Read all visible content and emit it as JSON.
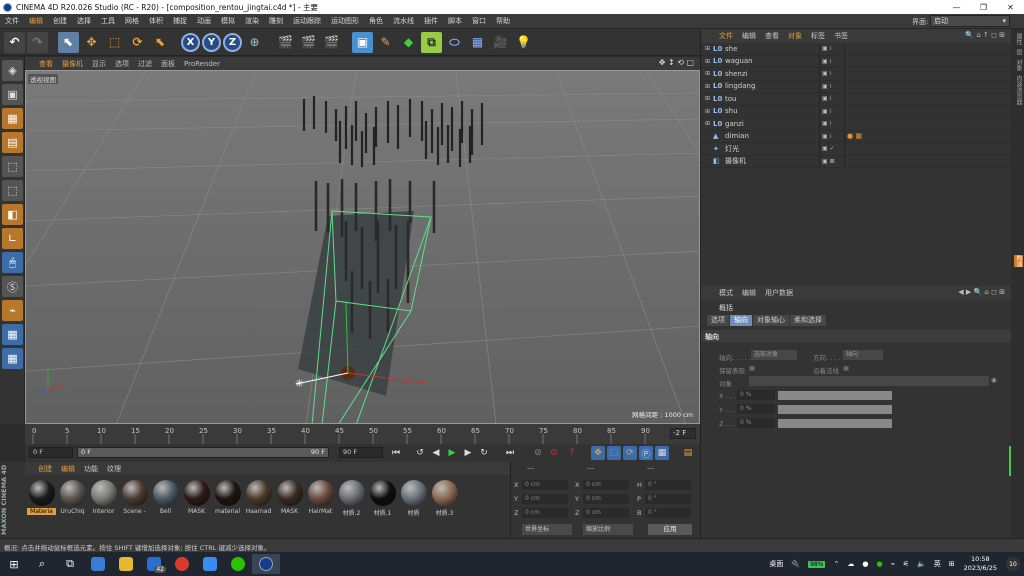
{
  "window": {
    "title": "CINEMA 4D R20.026 Studio (RC - R20) - [composition_rentou_jingtai.c4d *] - 主要",
    "minimize": "—",
    "maximize": "❐",
    "close": "✕"
  },
  "menu": {
    "items": [
      "文件",
      "编辑",
      "创建",
      "选择",
      "工具",
      "网格",
      "体积",
      "捕捉",
      "动画",
      "模拟",
      "渲染",
      "雕刻",
      "运动跟踪",
      "运动图形",
      "角色",
      "流水线",
      "插件",
      "脚本",
      "窗口",
      "帮助"
    ],
    "layout_label": "界面:",
    "layout_value": "启动"
  },
  "toolbar": {
    "axis_x": "X",
    "axis_y": "Y",
    "axis_z": "Z"
  },
  "viewport": {
    "menu": [
      "查看",
      "摄像机",
      "显示",
      "选项",
      "过滤",
      "面板",
      "ProRender"
    ],
    "label": "透视视图",
    "grid_info": "网格间距 : 1000 cm",
    "nav_icons": "✥ ↕ ⟲ ▢"
  },
  "timeline": {
    "ticks": [
      "0",
      "5",
      "10",
      "15",
      "20",
      "25",
      "30",
      "35",
      "40",
      "45",
      "50",
      "55",
      "60",
      "65",
      "70",
      "75",
      "80",
      "85",
      "90"
    ],
    "current_frame": "-2 F"
  },
  "transport": {
    "start_field": "0 F",
    "current_field": "0 F",
    "end_field_inner": "90 F",
    "end_field": "90 F"
  },
  "materials": {
    "menu": [
      "创建",
      "编辑",
      "功能",
      "纹理"
    ],
    "items": [
      {
        "name": "Materia",
        "color": "#1a1a1a"
      },
      {
        "name": "UruChiq",
        "color": "#5a5550"
      },
      {
        "name": "Interior",
        "color": "#7a7a76"
      },
      {
        "name": "Scene -",
        "color": "#4a3a30"
      },
      {
        "name": "Bell",
        "color": "#4a5a62"
      },
      {
        "name": "MASK",
        "color": "#2a1a16"
      },
      {
        "name": "material",
        "color": "#1e1412"
      },
      {
        "name": "Haarnad",
        "color": "#4a3a2a"
      },
      {
        "name": "MASK",
        "color": "#3a2a22"
      },
      {
        "name": "HairMat",
        "color": "#6a4a40"
      },
      {
        "name": "材质.2",
        "color": "#6a6e74"
      },
      {
        "name": "材质.1",
        "color": "#0e0e0e"
      },
      {
        "name": "材质",
        "color": "#6a707a"
      },
      {
        "name": "材质.3",
        "color": "#8a6a50"
      }
    ]
  },
  "brand": "MAXON CINEMA 4D",
  "coords": {
    "header_left": "---",
    "header_mid": "---",
    "header_right": "---",
    "rows": [
      {
        "a": "X",
        "av": "0 cm",
        "b": "X",
        "bv": "0 cm",
        "c": "H",
        "cv": "0 °"
      },
      {
        "a": "Y",
        "av": "0 cm",
        "b": "Y",
        "bv": "0 cm",
        "c": "P",
        "cv": "0 °"
      },
      {
        "a": "Z",
        "av": "0 cm",
        "b": "Z",
        "bv": "0 cm",
        "c": "B",
        "cv": "0 °"
      }
    ],
    "space_select": "世界坐标",
    "mode_select": "缩放比例",
    "apply": "应用"
  },
  "objects": {
    "menu": [
      "文件",
      "编辑",
      "查看",
      "对象",
      "标签",
      "书签"
    ],
    "icons": "🔍 ⌂ ↑ ◻ ⊞",
    "rows": [
      {
        "name": "she",
        "icon": "L0",
        "tags": ""
      },
      {
        "name": "waguan",
        "icon": "L0",
        "tags": ""
      },
      {
        "name": "shenzi",
        "icon": "L0",
        "tags": ""
      },
      {
        "name": "lingdang",
        "icon": "L0",
        "tags": ""
      },
      {
        "name": "tou",
        "icon": "L0",
        "tags": ""
      },
      {
        "name": "shu",
        "icon": "L0",
        "tags": ""
      },
      {
        "name": "ganzi",
        "icon": "L0",
        "tags": ""
      },
      {
        "name": "dimian",
        "icon": "▲",
        "tags": "● ▦"
      },
      {
        "name": "灯光",
        "icon": "✦",
        "tags": ""
      },
      {
        "name": "摄像机",
        "icon": "◧",
        "tags": ""
      }
    ]
  },
  "attributes": {
    "menu": [
      "模式",
      "编辑",
      "用户数据"
    ],
    "icons": "◀ ▶ 🔍 ⌂ ◻ ⊞",
    "title": "概括",
    "tabs": [
      "选项",
      "轴向",
      "对象轴心",
      "柔和选择"
    ],
    "section": "轴向",
    "axis_label": "轴向. . . . .",
    "axis_value": "选取对象",
    "orient_label": "方向. . . . .",
    "orient_value": "轴向",
    "keep_label": "保留表现",
    "normal_label": "沿着法线",
    "object_label": "对象",
    "x_label": "X . . . .",
    "x_value": "0 %",
    "y_label": "Y . . . .",
    "y_value": "0 %",
    "z_label": "Z . . . .",
    "z_value": "0 %"
  },
  "right_strip": [
    "属性",
    "层",
    "对象",
    "内容浏览器",
    "构造"
  ],
  "status": "概况: 点击并拖动鼠标框选元素。按住 SHIFT 键增加选择对象; 按住 CTRL 键减少选择对象。",
  "taskbar": {
    "badge": "42",
    "ime_label": "桌面",
    "battery": "98%",
    "lang": "英",
    "time": "10:58",
    "date": "2023/6/25",
    "notifications": "10"
  }
}
